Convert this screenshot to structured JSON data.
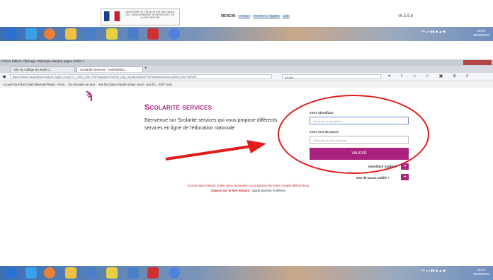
{
  "site_footer": {
    "gov_text": "MINISTÈRE DE L'ÉDUCATION NATIONALE DE L'ENSEIGNEMENT SUPÉRIEUR ET DE LA RECHERCHE",
    "links_prefix": "MENCIM - ",
    "link_contact": "contact",
    "link_legal": "mentions légales",
    "link_help": "aide",
    "version": "v6.5.9.6"
  },
  "taskbar": {
    "tray": "FR ▴ ▸ ▮▮ ◉ ◢ ◀)",
    "clock_time": "20:49",
    "clock_date": "25/09/2015"
  },
  "browser": {
    "menu": "Fichier  Édition  Affichage  Historique  Marque-pages  Outils  ?",
    "tab1": "Site du collège du lardé d...",
    "tab2": "Scolarité services - Authentifica...",
    "tab_new": "+",
    "url": "https://teleser.ac-poitiers.fr/login/ct_logon_vk.jsp?CT_ORIG_URL=%2Fdispatcher%2Fbvt_vsig_vac/nfg%3A%2F%2Fteleservices.ac-poitiers.fr%2Fdef%2F",
    "search": "ubuntu",
    "toolbar_icons": "▾ ⇩ ⌂ ☆ ▣ ⊕ ≡",
    "bookmarks": "Accueil YouTube     Gmail     MeventerPlanet - Form...     Ton domaine un jeux...     Yes No Game     Stredd     Amour Sucre, Jeu d'a...     ENT i-cart"
  },
  "page": {
    "logo": "ϡ",
    "app_title": "Scolarité services",
    "app_desc": "Bienvenue sur Scolarité services qui vous propose différents services en ligne de l'éducation nationale",
    "login": {
      "user_label": "votre identifiant",
      "user_placeholder": "Saisissez un identifiant",
      "pass_label": "votre mot de passe",
      "pass_placeholder": "Saisissez un mot de passe",
      "validate_label": "VALIDER",
      "forgot_user": "identifiant oublié ?",
      "forgot_pass": "mot de passe oublié ?",
      "forgot_btn": "➜"
    },
    "help_line1": "Si vous avez besoin d'aide dans l'activation ou la gestion de votre compte téléservices,",
    "help_line2": "cliquez sur le lien suivant : ",
    "help_link": "guide parents et élèves."
  },
  "colors": {
    "brand": "#a9237e",
    "annotation": "#e21b1b"
  }
}
